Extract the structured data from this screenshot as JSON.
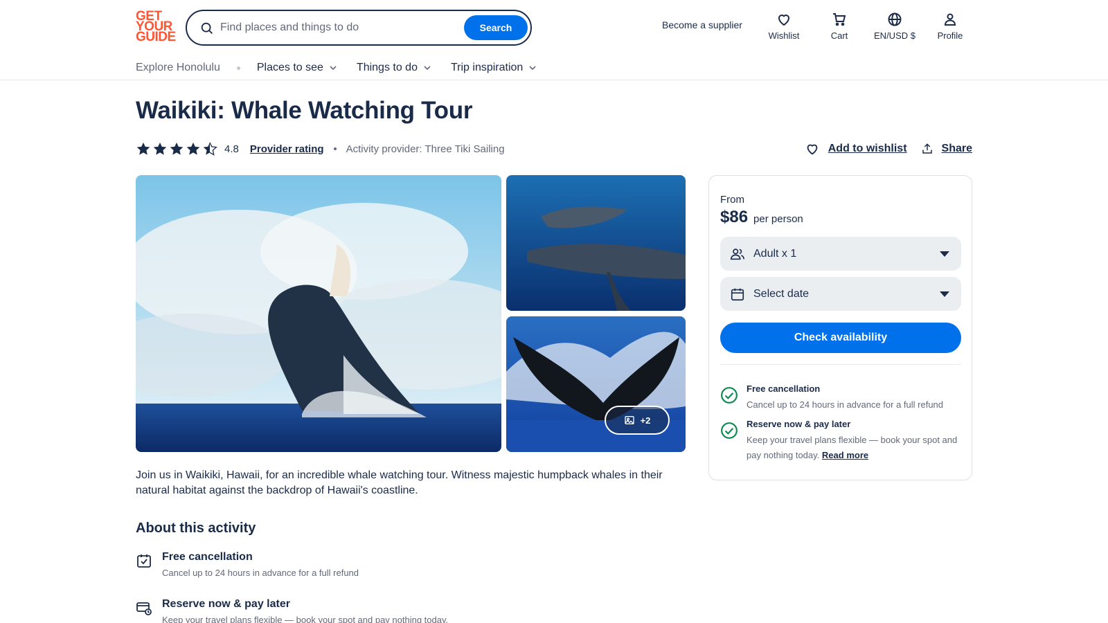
{
  "logo": {
    "line1": "GET",
    "line2": "YOUR",
    "line3": "GUIDE"
  },
  "search": {
    "placeholder": "Find places and things to do",
    "button_label": "Search"
  },
  "header": {
    "supplier_label": "Become a supplier",
    "nav": [
      {
        "label": "Wishlist",
        "icon": "heart-icon"
      },
      {
        "label": "Cart",
        "icon": "cart-icon"
      },
      {
        "label": "EN/USD $",
        "icon": "globe-icon"
      },
      {
        "label": "Profile",
        "icon": "profile-icon"
      }
    ]
  },
  "subnav": {
    "explore": "Explore Honolulu",
    "items": [
      "Places to see",
      "Things to do",
      "Trip inspiration"
    ]
  },
  "activity": {
    "title": "Waikiki: Whale Watching Tour",
    "rating": "4.8",
    "rating_fraction": 0.96,
    "provider_rating_label": "Provider rating",
    "provider": "Activity provider: Three Tiki Sailing",
    "wishlist_label": "Add to wishlist",
    "share_label": "Share",
    "more_photos": "+2",
    "description": "Join us in Waikiki, Hawaii, for an incredible whale watching tour. Witness majestic humpback whales in their natural habitat against the backdrop of Hawaii's coastline."
  },
  "about": {
    "heading": "About this activity",
    "items": [
      {
        "title": "Free cancellation",
        "sub": "Cancel up to 24 hours in advance for a full refund",
        "icon": "calendar-check-icon"
      },
      {
        "title": "Reserve now & pay later",
        "sub": "Keep your travel plans flexible — book your spot and pay nothing today.",
        "icon": "card-clock-icon"
      }
    ]
  },
  "booking": {
    "from_label": "From",
    "price": "$86",
    "per_person": "per person",
    "participants": "Adult x 1",
    "date": "Select date",
    "cta": "Check availability",
    "perks": [
      {
        "title": "Free cancellation",
        "sub": "Cancel up to 24 hours in advance for a full refund"
      },
      {
        "title": "Reserve now & pay later",
        "sub": "Keep your travel plans flexible — book your spot and pay nothing today.",
        "read_more": "Read more"
      }
    ]
  },
  "colors": {
    "brand": "#ff5533",
    "primary": "#0071eb",
    "text": "#1a2b49",
    "muted": "#63687a",
    "success": "#0b8a4f"
  }
}
